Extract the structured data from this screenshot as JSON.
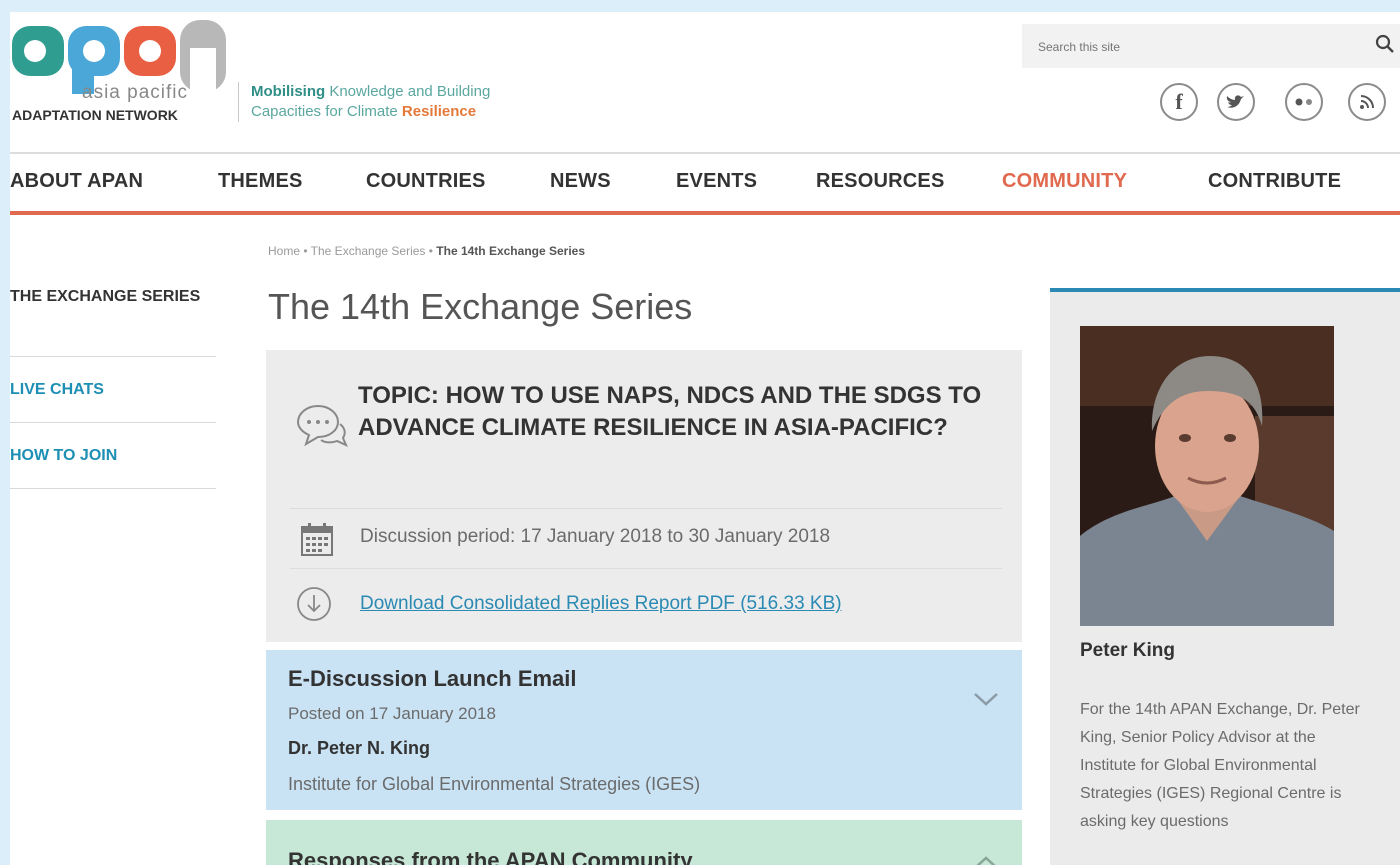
{
  "header": {
    "logo_letters": "apan",
    "logo_sub": "asia pacific",
    "logo_org": "ADAPTATION NETWORK",
    "tagline_line1_bold": "Mobilising",
    "tagline_line1_rest": " Knowledge and Building",
    "tagline_line2_prefix": "Capacities for Climate ",
    "tagline_line2_accent": "Resilience",
    "search_placeholder": "Search this site",
    "social": [
      "facebook-icon",
      "twitter-icon",
      "flickr-icon",
      "rss-icon"
    ]
  },
  "nav": {
    "items": [
      {
        "label": "ABOUT APAN"
      },
      {
        "label": "THEMES"
      },
      {
        "label": "COUNTRIES"
      },
      {
        "label": "NEWS"
      },
      {
        "label": "EVENTS"
      },
      {
        "label": "RESOURCES"
      },
      {
        "label": "COMMUNITY"
      },
      {
        "label": "CONTRIBUTE"
      }
    ],
    "active": "COMMUNITY"
  },
  "breadcrumb": {
    "home": "Home",
    "sep": " • ",
    "parent": "The Exchange Series",
    "current": "The 14th Exchange Series"
  },
  "page_title": "The 14th Exchange Series",
  "sidebar": {
    "items": [
      {
        "label": "THE EXCHANGE SERIES"
      },
      {
        "label": "LIVE CHATS"
      },
      {
        "label": "HOW TO JOIN"
      }
    ]
  },
  "topic": {
    "title": "TOPIC: HOW TO USE NAPS, NDCS AND THE SDGS TO ADVANCE CLIMATE RESILIENCE IN ASIA-PACIFIC?",
    "period": "Discussion period: 17 January 2018 to 30 January 2018",
    "download": "Download Consolidated Replies Report PDF (516.33 KB)"
  },
  "email_panel": {
    "title": "E-Discussion Launch Email",
    "posted": "Posted on 17 January 2018",
    "author": "Dr. Peter N. King",
    "org": "Institute for Global Environmental Strategies (IGES)"
  },
  "responses_panel": {
    "title": "Responses from the APAN Community"
  },
  "profile": {
    "name": "Peter King",
    "bio": "For the 14th APAN Exchange, Dr. Peter King, Senior Policy Advisor at the Institute for Global Environmental Strategies (IGES) Regional Centre is asking key questions"
  },
  "colors": {
    "accent": "#e0694f",
    "link": "#2a8ab3",
    "frame": "#ddeefb",
    "email_panel": "#c9e3f5",
    "responses_panel": "#c7e8d6"
  }
}
